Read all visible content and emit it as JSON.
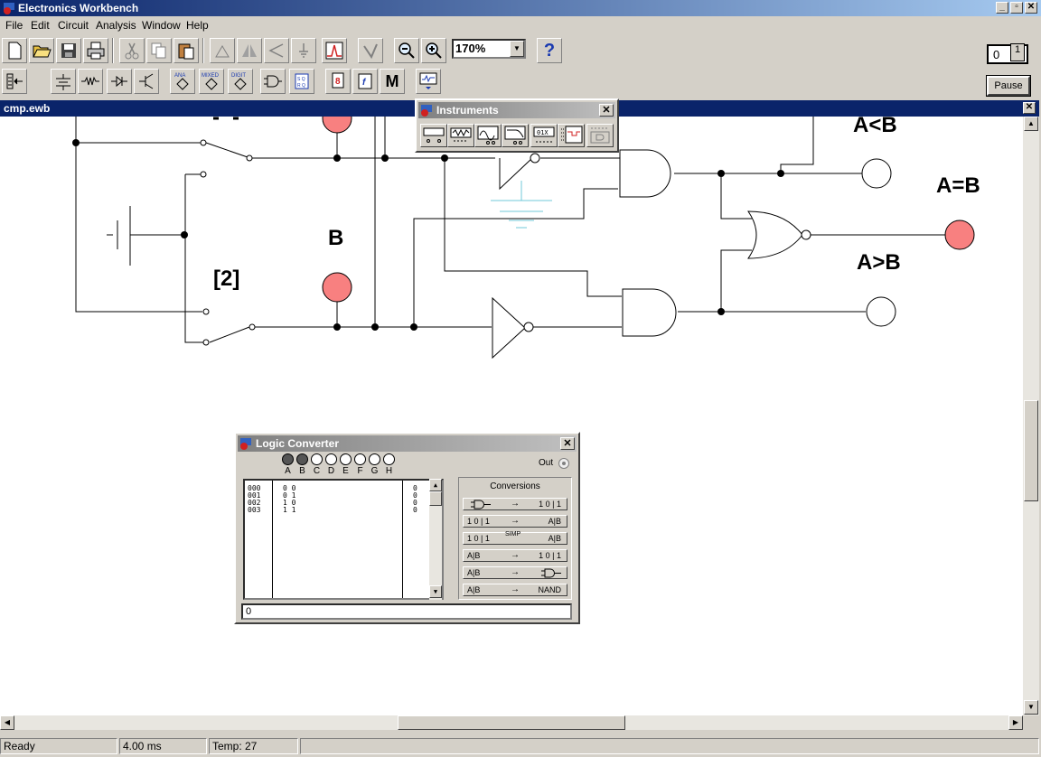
{
  "app": {
    "title": "Electronics Workbench",
    "window_controls": [
      "_",
      "▫",
      "✕"
    ]
  },
  "menu": [
    "File",
    "Edit",
    "Circuit",
    "Analysis",
    "Window",
    "Help"
  ],
  "toolbar": {
    "zoom_value": "170%",
    "help_label": "?",
    "pause_label": "Pause",
    "power_off_label": "0",
    "power_on_label": "1",
    "parts_labels": [
      "ANA",
      "MIXED",
      "DIGIT"
    ],
    "misc_label": "M",
    "func_label": "f"
  },
  "document": {
    "title": "cmp.ewb",
    "close_label": "✕"
  },
  "circuit": {
    "labels": {
      "a_less_b": "A<B",
      "a_eq_b": "A=B",
      "a_gt_b": "A>B",
      "b_label": "B",
      "switch_key": "[2]"
    },
    "colors": {
      "lamp_on": "#f88080",
      "ground": "#70c8d8"
    }
  },
  "instruments": {
    "title": "Instruments",
    "close_label": "✕"
  },
  "logic_converter": {
    "title": "Logic Converter",
    "close_label": "✕",
    "variables": [
      {
        "name": "A",
        "active": true
      },
      {
        "name": "B",
        "active": true
      },
      {
        "name": "C",
        "active": false
      },
      {
        "name": "D",
        "active": false
      },
      {
        "name": "E",
        "active": false
      },
      {
        "name": "F",
        "active": false
      },
      {
        "name": "G",
        "active": false
      },
      {
        "name": "H",
        "active": false
      }
    ],
    "out_label": "Out",
    "rows": [
      {
        "index": "000",
        "ab": "0  0",
        "out": "0"
      },
      {
        "index": "001",
        "ab": "0  1",
        "out": "0"
      },
      {
        "index": "002",
        "ab": "1  0",
        "out": "0"
      },
      {
        "index": "003",
        "ab": "1  1",
        "out": "0"
      }
    ],
    "conversions_title": "Conversions",
    "conversions": [
      {
        "from": "gate",
        "to": "1 0 | 1"
      },
      {
        "from": "1 0 | 1",
        "to": "A|B"
      },
      {
        "from": "1 0 | 1",
        "mid": "SIMP",
        "to": "A|B"
      },
      {
        "from": "A|B",
        "to": "1 0 | 1"
      },
      {
        "from": "A|B",
        "to": "gate"
      },
      {
        "from": "A|B",
        "to": "NAND"
      }
    ],
    "expression": "0"
  },
  "status": {
    "state": "Ready",
    "time": "4.00 ms",
    "temp": "Temp:  27"
  }
}
